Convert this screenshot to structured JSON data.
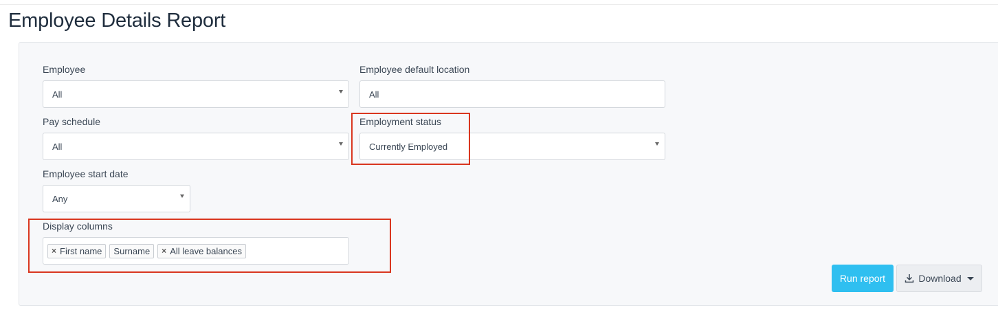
{
  "page": {
    "title": "Employee Details Report"
  },
  "filters": {
    "employee": {
      "label": "Employee",
      "value": "All"
    },
    "location": {
      "label": "Employee default location",
      "value": "All"
    },
    "pay_schedule": {
      "label": "Pay schedule",
      "value": "All"
    },
    "employment_status": {
      "label": "Employment status",
      "value": "Currently Employed"
    },
    "start_date": {
      "label": "Employee start date",
      "value": "Any"
    },
    "display_columns": {
      "label": "Display columns",
      "tags": [
        "First name",
        "Surname",
        "All leave balances"
      ],
      "removable": [
        true,
        false,
        true
      ]
    }
  },
  "actions": {
    "run_label": "Run report",
    "download_label": "Download"
  },
  "colors": {
    "accent": "#2fbff0",
    "highlight": "#d9361f"
  }
}
